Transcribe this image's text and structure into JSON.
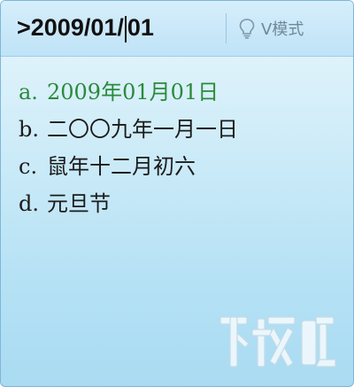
{
  "composition": {
    "before_caret": ">2009/01/",
    "after_caret": "01"
  },
  "mode_button": {
    "icon": "lightbulb-icon",
    "label": "V模式"
  },
  "candidates": [
    {
      "key": "a.",
      "text": "2009年01月01日",
      "selected": true
    },
    {
      "key": "b.",
      "text": "二〇〇九年一月一日",
      "selected": false
    },
    {
      "key": "c.",
      "text": "鼠年十二月初六",
      "selected": false
    },
    {
      "key": "d.",
      "text": "元旦节",
      "selected": false
    }
  ],
  "watermark": {
    "text": "下载吧"
  },
  "colors": {
    "selected_candidate": "#2a8a3b",
    "panel_blue": "#b7e2f5",
    "border": "#7fb6d9"
  }
}
